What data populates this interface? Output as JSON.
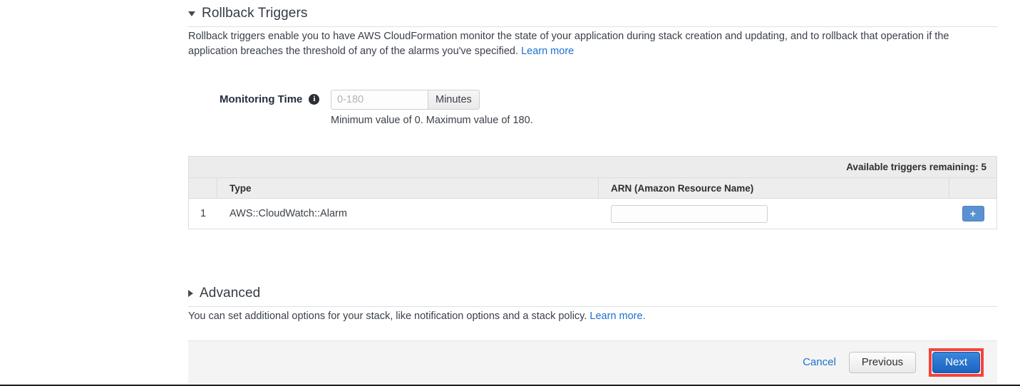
{
  "rollback_section": {
    "title": "Rollback Triggers",
    "expanded": true,
    "disclosure_icon": "triangle-down-icon",
    "description_part1": "Rollback triggers enable you to have AWS CloudFormation monitor the state of your application during stack creation and updating, and to rollback that operation if the application breaches the threshold of any of the alarms you've specified.",
    "learn_more_label": "Learn more"
  },
  "monitoring_time": {
    "label": "Monitoring Time",
    "info_icon": "info-icon",
    "info_glyph": "i",
    "value": "",
    "placeholder": "0-180",
    "unit_label": "Minutes",
    "hint": "Minimum value of 0. Maximum value of 180."
  },
  "triggers_table": {
    "toolbar_text": "Available triggers remaining: 5",
    "columns": {
      "index": "",
      "type": "Type",
      "arn": "ARN (Amazon Resource Name)",
      "actions": ""
    },
    "rows": [
      {
        "index": "1",
        "type": "AWS::CloudWatch::Alarm",
        "arn_value": "",
        "arn_placeholder": "",
        "add_button_label": "+",
        "add_button_icon": "plus-icon"
      }
    ]
  },
  "advanced_section": {
    "title": "Advanced",
    "expanded": false,
    "disclosure_icon": "triangle-right-icon",
    "description": "You can set additional options for your stack, like notification options and a stack policy.",
    "learn_more_label": "Learn more."
  },
  "footer": {
    "cancel_label": "Cancel",
    "previous_label": "Previous",
    "next_label": "Next"
  },
  "colors": {
    "link": "#1c6fd1",
    "primary_button": "#1b63bf",
    "highlight_outline": "#f4433a",
    "add_button": "#5b91d0"
  }
}
